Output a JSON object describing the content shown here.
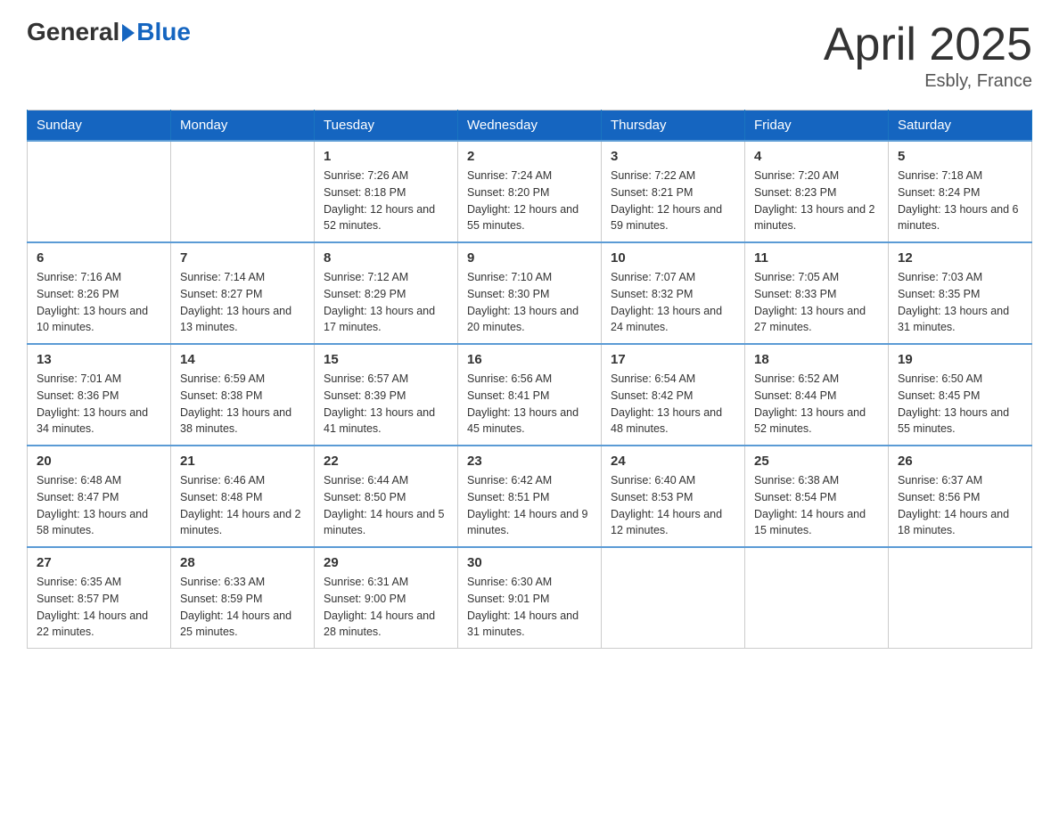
{
  "header": {
    "logo_general": "General",
    "logo_blue": "Blue",
    "month_year": "April 2025",
    "location": "Esbly, France"
  },
  "weekdays": [
    "Sunday",
    "Monday",
    "Tuesday",
    "Wednesday",
    "Thursday",
    "Friday",
    "Saturday"
  ],
  "weeks": [
    [
      {
        "day": "",
        "info": ""
      },
      {
        "day": "",
        "info": ""
      },
      {
        "day": "1",
        "info": "Sunrise: 7:26 AM\nSunset: 8:18 PM\nDaylight: 12 hours\nand 52 minutes."
      },
      {
        "day": "2",
        "info": "Sunrise: 7:24 AM\nSunset: 8:20 PM\nDaylight: 12 hours\nand 55 minutes."
      },
      {
        "day": "3",
        "info": "Sunrise: 7:22 AM\nSunset: 8:21 PM\nDaylight: 12 hours\nand 59 minutes."
      },
      {
        "day": "4",
        "info": "Sunrise: 7:20 AM\nSunset: 8:23 PM\nDaylight: 13 hours\nand 2 minutes."
      },
      {
        "day": "5",
        "info": "Sunrise: 7:18 AM\nSunset: 8:24 PM\nDaylight: 13 hours\nand 6 minutes."
      }
    ],
    [
      {
        "day": "6",
        "info": "Sunrise: 7:16 AM\nSunset: 8:26 PM\nDaylight: 13 hours\nand 10 minutes."
      },
      {
        "day": "7",
        "info": "Sunrise: 7:14 AM\nSunset: 8:27 PM\nDaylight: 13 hours\nand 13 minutes."
      },
      {
        "day": "8",
        "info": "Sunrise: 7:12 AM\nSunset: 8:29 PM\nDaylight: 13 hours\nand 17 minutes."
      },
      {
        "day": "9",
        "info": "Sunrise: 7:10 AM\nSunset: 8:30 PM\nDaylight: 13 hours\nand 20 minutes."
      },
      {
        "day": "10",
        "info": "Sunrise: 7:07 AM\nSunset: 8:32 PM\nDaylight: 13 hours\nand 24 minutes."
      },
      {
        "day": "11",
        "info": "Sunrise: 7:05 AM\nSunset: 8:33 PM\nDaylight: 13 hours\nand 27 minutes."
      },
      {
        "day": "12",
        "info": "Sunrise: 7:03 AM\nSunset: 8:35 PM\nDaylight: 13 hours\nand 31 minutes."
      }
    ],
    [
      {
        "day": "13",
        "info": "Sunrise: 7:01 AM\nSunset: 8:36 PM\nDaylight: 13 hours\nand 34 minutes."
      },
      {
        "day": "14",
        "info": "Sunrise: 6:59 AM\nSunset: 8:38 PM\nDaylight: 13 hours\nand 38 minutes."
      },
      {
        "day": "15",
        "info": "Sunrise: 6:57 AM\nSunset: 8:39 PM\nDaylight: 13 hours\nand 41 minutes."
      },
      {
        "day": "16",
        "info": "Sunrise: 6:56 AM\nSunset: 8:41 PM\nDaylight: 13 hours\nand 45 minutes."
      },
      {
        "day": "17",
        "info": "Sunrise: 6:54 AM\nSunset: 8:42 PM\nDaylight: 13 hours\nand 48 minutes."
      },
      {
        "day": "18",
        "info": "Sunrise: 6:52 AM\nSunset: 8:44 PM\nDaylight: 13 hours\nand 52 minutes."
      },
      {
        "day": "19",
        "info": "Sunrise: 6:50 AM\nSunset: 8:45 PM\nDaylight: 13 hours\nand 55 minutes."
      }
    ],
    [
      {
        "day": "20",
        "info": "Sunrise: 6:48 AM\nSunset: 8:47 PM\nDaylight: 13 hours\nand 58 minutes."
      },
      {
        "day": "21",
        "info": "Sunrise: 6:46 AM\nSunset: 8:48 PM\nDaylight: 14 hours\nand 2 minutes."
      },
      {
        "day": "22",
        "info": "Sunrise: 6:44 AM\nSunset: 8:50 PM\nDaylight: 14 hours\nand 5 minutes."
      },
      {
        "day": "23",
        "info": "Sunrise: 6:42 AM\nSunset: 8:51 PM\nDaylight: 14 hours\nand 9 minutes."
      },
      {
        "day": "24",
        "info": "Sunrise: 6:40 AM\nSunset: 8:53 PM\nDaylight: 14 hours\nand 12 minutes."
      },
      {
        "day": "25",
        "info": "Sunrise: 6:38 AM\nSunset: 8:54 PM\nDaylight: 14 hours\nand 15 minutes."
      },
      {
        "day": "26",
        "info": "Sunrise: 6:37 AM\nSunset: 8:56 PM\nDaylight: 14 hours\nand 18 minutes."
      }
    ],
    [
      {
        "day": "27",
        "info": "Sunrise: 6:35 AM\nSunset: 8:57 PM\nDaylight: 14 hours\nand 22 minutes."
      },
      {
        "day": "28",
        "info": "Sunrise: 6:33 AM\nSunset: 8:59 PM\nDaylight: 14 hours\nand 25 minutes."
      },
      {
        "day": "29",
        "info": "Sunrise: 6:31 AM\nSunset: 9:00 PM\nDaylight: 14 hours\nand 28 minutes."
      },
      {
        "day": "30",
        "info": "Sunrise: 6:30 AM\nSunset: 9:01 PM\nDaylight: 14 hours\nand 31 minutes."
      },
      {
        "day": "",
        "info": ""
      },
      {
        "day": "",
        "info": ""
      },
      {
        "day": "",
        "info": ""
      }
    ]
  ]
}
